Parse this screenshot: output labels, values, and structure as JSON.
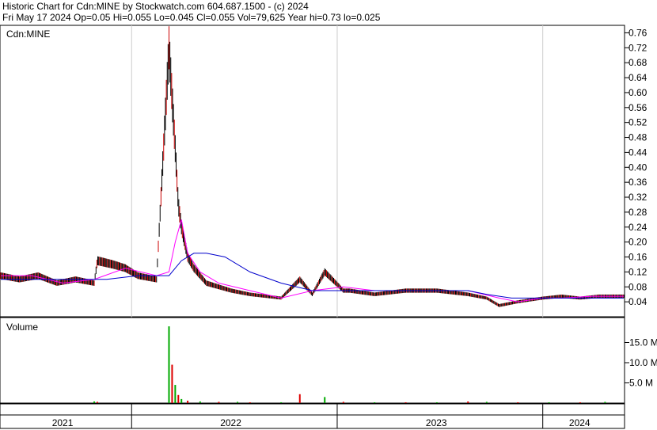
{
  "header": {
    "line1": "Historic Chart for Cdn:MINE by Stockwatch.com 604.687.1500 - (c) 2024",
    "line2": "Fri May 17 2024  Op=0.05  Hi=0.055  Lo=0.045  Cl=0.055  Vol=79,625  Year hi=0.73  lo=0.025"
  },
  "colors": {
    "candle_up": "#000000",
    "candle_down": "#cc0000",
    "ma_short": "#ff00ff",
    "ma_long": "#0000cc",
    "volume_up": "#00aa00",
    "volume_down": "#dd0000",
    "gridline": "#cccccc",
    "frame": "#000000"
  },
  "chart_data": [
    {
      "type": "candlestick",
      "title": "Cdn:MINE",
      "ylim": [
        0,
        0.78
      ],
      "y_ticks": [
        "0.76",
        "0.72",
        "0.68",
        "0.64",
        "0.60",
        "0.56",
        "0.52",
        "0.48",
        "0.44",
        "0.40",
        "0.36",
        "0.32",
        "0.28",
        "0.24",
        "0.20",
        "0.16",
        "0.12",
        "0.08",
        "0.04"
      ],
      "x_year_labels": [
        "2021",
        "2022",
        "2023",
        "2024"
      ],
      "grid": true,
      "series": [
        {
          "kind": "price",
          "x": [
            0.0,
            0.03,
            0.06,
            0.09,
            0.12,
            0.15,
            0.155,
            0.18,
            0.2,
            0.22,
            0.25,
            0.27,
            0.28,
            0.285,
            0.29,
            0.295,
            0.3,
            0.31,
            0.32,
            0.33,
            0.35,
            0.37,
            0.4,
            0.45,
            0.48,
            0.5,
            0.52,
            0.55,
            0.56,
            0.6,
            0.65,
            0.7,
            0.75,
            0.78,
            0.8,
            0.83,
            0.87,
            0.9,
            0.93,
            0.96,
            1.0
          ],
          "values": [
            0.11,
            0.1,
            0.11,
            0.09,
            0.1,
            0.09,
            0.15,
            0.14,
            0.13,
            0.11,
            0.1,
            0.72,
            0.45,
            0.3,
            0.24,
            0.2,
            0.16,
            0.13,
            0.11,
            0.09,
            0.08,
            0.07,
            0.06,
            0.05,
            0.1,
            0.06,
            0.12,
            0.07,
            0.07,
            0.06,
            0.07,
            0.07,
            0.06,
            0.05,
            0.03,
            0.04,
            0.05,
            0.055,
            0.05,
            0.055,
            0.055
          ]
        },
        {
          "kind": "ma-short",
          "x": [
            0.0,
            0.05,
            0.1,
            0.15,
            0.2,
            0.25,
            0.27,
            0.28,
            0.29,
            0.3,
            0.32,
            0.35,
            0.4,
            0.45,
            0.5,
            0.55,
            0.6,
            0.65,
            0.7,
            0.75,
            0.8,
            0.83,
            0.87,
            0.9,
            0.95,
            1.0
          ],
          "values": [
            0.11,
            0.11,
            0.09,
            0.1,
            0.13,
            0.11,
            0.12,
            0.2,
            0.26,
            0.17,
            0.12,
            0.09,
            0.07,
            0.05,
            0.07,
            0.08,
            0.07,
            0.07,
            0.07,
            0.07,
            0.05,
            0.04,
            0.05,
            0.05,
            0.055,
            0.055
          ]
        },
        {
          "kind": "ma-long",
          "x": [
            0.0,
            0.1,
            0.17,
            0.22,
            0.27,
            0.29,
            0.31,
            0.33,
            0.36,
            0.4,
            0.45,
            0.5,
            0.55,
            0.6,
            0.65,
            0.7,
            0.75,
            0.78,
            0.82,
            0.85,
            0.9,
            0.95,
            1.0
          ],
          "values": [
            0.1,
            0.1,
            0.1,
            0.11,
            0.11,
            0.15,
            0.17,
            0.17,
            0.16,
            0.12,
            0.09,
            0.07,
            0.07,
            0.07,
            0.07,
            0.07,
            0.07,
            0.06,
            0.05,
            0.05,
            0.05,
            0.05,
            0.05
          ]
        }
      ]
    },
    {
      "type": "bar",
      "title": "Volume",
      "ylim": [
        0,
        20.0
      ],
      "y_ticks": [
        "15.0 M",
        "10.0 M",
        "5.0 M"
      ],
      "x": [
        0.15,
        0.155,
        0.27,
        0.275,
        0.28,
        0.285,
        0.29,
        0.3,
        0.32,
        0.35,
        0.38,
        0.4,
        0.45,
        0.48,
        0.52,
        0.55,
        0.6,
        0.65,
        0.7,
        0.75,
        0.78,
        0.83,
        0.88,
        0.93,
        0.97
      ],
      "values": [
        0.4,
        0.3,
        19.0,
        9.5,
        4.5,
        2.0,
        1.0,
        0.6,
        0.4,
        0.3,
        0.3,
        0.2,
        0.2,
        2.2,
        1.5,
        0.3,
        0.2,
        0.2,
        0.2,
        0.4,
        0.3,
        0.2,
        0.2,
        0.2,
        0.3
      ]
    }
  ]
}
